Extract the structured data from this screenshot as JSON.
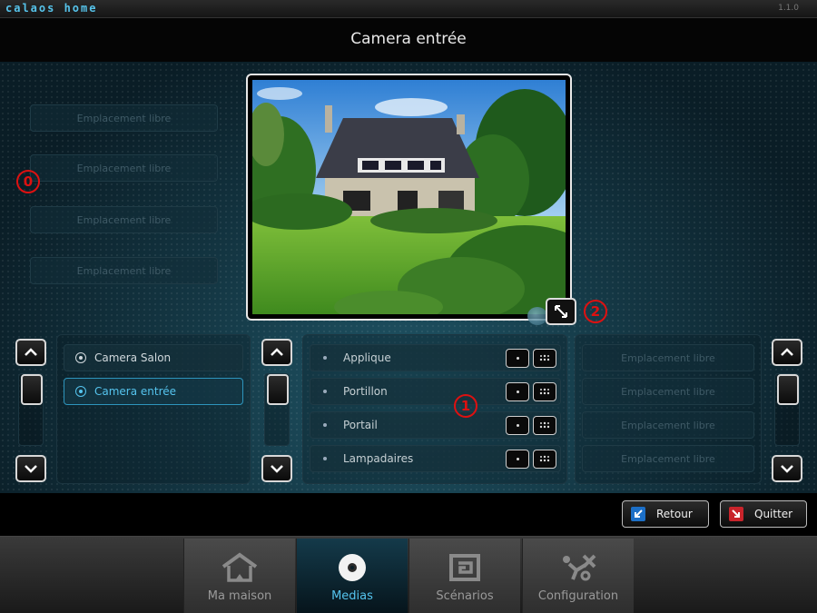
{
  "app": {
    "logo": "calaos home",
    "version": "1.1.0"
  },
  "header": {
    "title": "Camera entrée"
  },
  "left_slots": [
    "Emplacement libre",
    "Emplacement libre",
    "Emplacement libre",
    "Emplacement libre"
  ],
  "markers": {
    "m0": "0",
    "m1": "1",
    "m2": "2"
  },
  "cameras": [
    {
      "label": "Camera Salon",
      "selected": false
    },
    {
      "label": "Camera entrée",
      "selected": true
    }
  ],
  "lights": [
    "Applique",
    "Portillon",
    "Portail",
    "Lampadaires"
  ],
  "right_slots": [
    "Emplacement libre",
    "Emplacement libre",
    "Emplacement libre",
    "Emplacement libre"
  ],
  "actions": {
    "back": "Retour",
    "quit": "Quitter"
  },
  "nav": [
    {
      "label": "Ma maison",
      "icon": "house-icon",
      "active": false
    },
    {
      "label": "Medias",
      "icon": "disc-icon",
      "active": true
    },
    {
      "label": "Scénarios",
      "icon": "scenario-icon",
      "active": false
    },
    {
      "label": "Configuration",
      "icon": "config-icon",
      "active": false
    }
  ],
  "colors": {
    "accent": "#55c4ee",
    "marker": "#dd1111",
    "panel": "#0d2530"
  }
}
